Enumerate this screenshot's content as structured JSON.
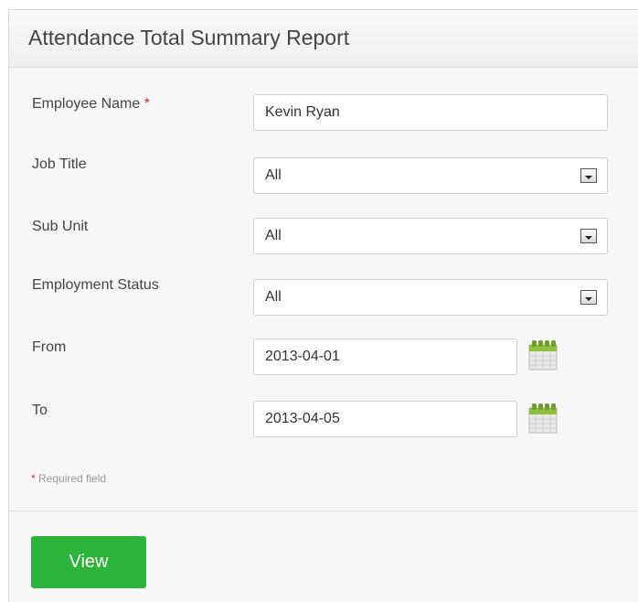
{
  "header": {
    "title": "Attendance Total Summary Report"
  },
  "form": {
    "employee_name": {
      "label": "Employee Name",
      "required_mark": "*",
      "value": "Kevin Ryan"
    },
    "job_title": {
      "label": "Job Title",
      "value": "All"
    },
    "sub_unit": {
      "label": "Sub Unit",
      "value": "All"
    },
    "employment_status": {
      "label": "Employment Status",
      "value": "All"
    },
    "from": {
      "label": "From",
      "value": "2013-04-01"
    },
    "to": {
      "label": "To",
      "value": "2013-04-05"
    }
  },
  "required_note": {
    "mark": "*",
    "text": "Required field"
  },
  "actions": {
    "view_label": "View"
  },
  "colors": {
    "primary_button": "#2bb33a",
    "required": "#c0392b"
  },
  "icons": [
    "dropdown-arrow-icon",
    "calendar-icon"
  ]
}
